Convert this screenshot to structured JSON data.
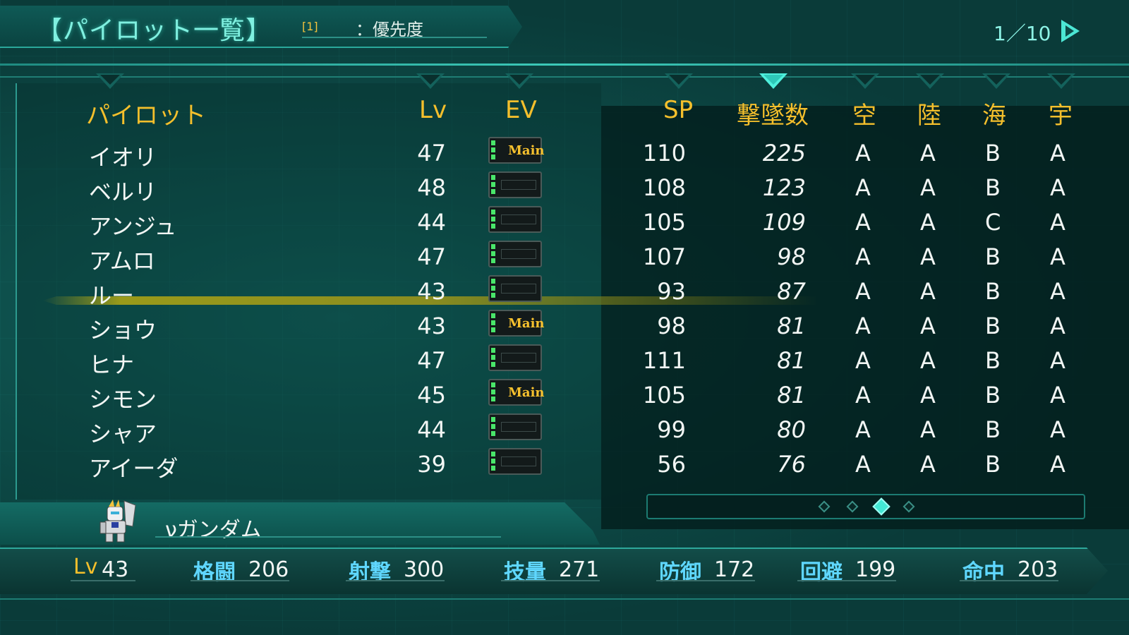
{
  "header": {
    "title": "【パイロット一覧】",
    "priority_key": "[1]",
    "priority_label": "：優先度",
    "page_indicator": "1／10"
  },
  "columns": {
    "pilot": "パイロット",
    "lv": "Lv",
    "ev": "EV",
    "sp": "SP",
    "kills": "撃墜数",
    "air": "空",
    "land": "陸",
    "sea": "海",
    "space": "宇"
  },
  "active_sort": "kills",
  "rows": [
    {
      "name": "イオリ",
      "lv": "47",
      "ev": "Main",
      "sp": "110",
      "kills": "225",
      "air": "A",
      "land": "A",
      "sea": "B",
      "space": "A"
    },
    {
      "name": "ベルリ",
      "lv": "48",
      "ev": "",
      "sp": "108",
      "kills": "123",
      "air": "A",
      "land": "A",
      "sea": "B",
      "space": "A"
    },
    {
      "name": "アンジュ",
      "lv": "44",
      "ev": "",
      "sp": "105",
      "kills": "109",
      "air": "A",
      "land": "A",
      "sea": "C",
      "space": "A"
    },
    {
      "name": "アムロ",
      "lv": "47",
      "ev": "",
      "sp": "107",
      "kills": "98",
      "air": "A",
      "land": "A",
      "sea": "B",
      "space": "A"
    },
    {
      "name": "ルー",
      "lv": "43",
      "ev": "",
      "sp": "93",
      "kills": "87",
      "air": "A",
      "land": "A",
      "sea": "B",
      "space": "A"
    },
    {
      "name": "ショウ",
      "lv": "43",
      "ev": "Main",
      "sp": "98",
      "kills": "81",
      "air": "A",
      "land": "A",
      "sea": "B",
      "space": "A"
    },
    {
      "name": "ヒナ",
      "lv": "47",
      "ev": "",
      "sp": "111",
      "kills": "81",
      "air": "A",
      "land": "A",
      "sea": "B",
      "space": "A"
    },
    {
      "name": "シモン",
      "lv": "45",
      "ev": "Main",
      "sp": "105",
      "kills": "81",
      "air": "A",
      "land": "A",
      "sea": "B",
      "space": "A"
    },
    {
      "name": "シャア",
      "lv": "44",
      "ev": "",
      "sp": "99",
      "kills": "80",
      "air": "A",
      "land": "A",
      "sea": "B",
      "space": "A"
    },
    {
      "name": "アイーダ",
      "lv": "39",
      "ev": "",
      "sp": "56",
      "kills": "76",
      "air": "A",
      "land": "A",
      "sea": "B",
      "space": "A"
    }
  ],
  "selected_row_index": 4,
  "pager": {
    "count": 4,
    "active": 2
  },
  "unit": {
    "name": "νガンダム",
    "icon": "mobile-suit-icon"
  },
  "stats": {
    "lv_label": "Lv",
    "lv": "43",
    "melee_label": "格闘",
    "melee": "206",
    "shoot_label": "射撃",
    "shoot": "300",
    "skill_label": "技量",
    "skill": "271",
    "defense_label": "防御",
    "defense": "172",
    "evade_label": "回避",
    "evade": "199",
    "hit_label": "命中",
    "hit": "203"
  },
  "colors": {
    "header_text": "#f4bf2c",
    "stat_label": "#5fd7ff",
    "accent": "#4ff0dc"
  }
}
